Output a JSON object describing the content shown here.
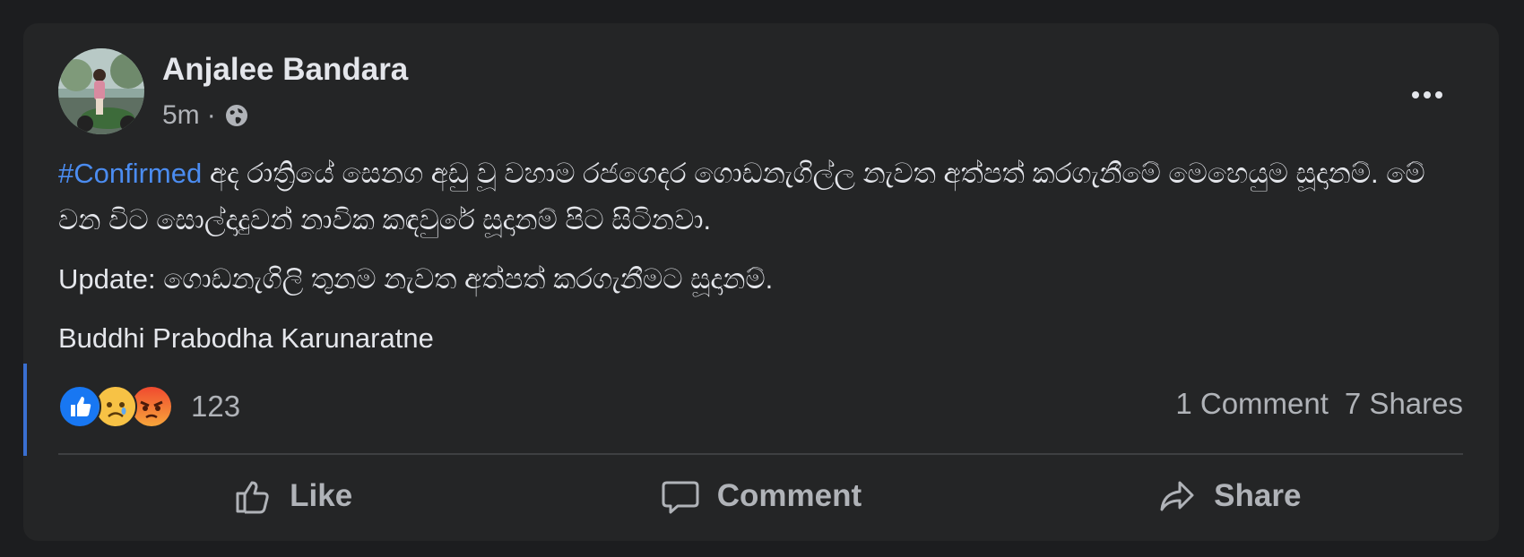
{
  "post": {
    "author": "Anjalee Bandara",
    "time": "5m",
    "separator": "·",
    "privacy_icon": "globe-icon",
    "more_icon": "more-options-icon",
    "hashtag": "#Confirmed",
    "line1_rest": " අද රාත්‍රියේ සෙනග අඩු වූ වහාම රජගෙදර ගොඩනැගිල්ල නැවත අත්පත් කරගැනීමේ මෙහෙයුම සූදානම්. මේ වන විට සොල්දාදුවන් නාවික කඳවුරේ සූදානම් පිට සිටිනවා.",
    "update_label": "Update:",
    "update_text": " ගොඩනැගිලි තුනම නැවත අත්පත් කරගැනීමට සූදානම්.",
    "signature": "Buddhi Prabodha Karunaratne"
  },
  "reactions": {
    "icons": [
      "like-reaction-icon",
      "sad-reaction-icon",
      "angry-reaction-icon"
    ],
    "count": "123",
    "comments": "1 Comment",
    "shares": "7 Shares"
  },
  "actions": {
    "like": "Like",
    "comment": "Comment",
    "share": "Share"
  },
  "colors": {
    "background": "#1c1d1f",
    "card": "#242526",
    "hashtag": "#4b8cf0",
    "like_blue": "#1877f2",
    "angry_red": "#f04a2f",
    "sad_yellow": "#f7c245"
  }
}
